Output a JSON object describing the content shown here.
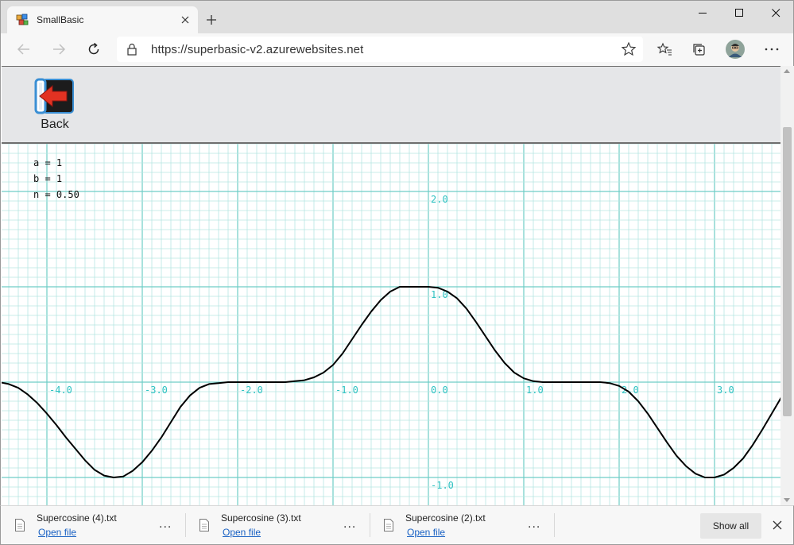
{
  "browser": {
    "tab_title": "SmallBasic",
    "url": "https://superbasic-v2.azurewebsites.net",
    "icons": [
      "smallbasic-favicon",
      "close-icon",
      "plus-icon",
      "minimize-icon",
      "maximize-icon",
      "window-close-icon",
      "back-arrow-icon",
      "forward-arrow-icon",
      "refresh-icon",
      "lock-icon",
      "star-icon",
      "favorites-icon",
      "collections-icon",
      "profile-avatar",
      "more-icon"
    ]
  },
  "app": {
    "back_label": "Back",
    "params": [
      "a = 1",
      "b = 1",
      "n = 0.50"
    ],
    "colors": {
      "grid_minor": "#b6e6e3",
      "grid_major": "#6fcdc6",
      "axis_label": "#2fc2c2",
      "curve": "#000000",
      "toolbar_bg": "#e5e6e8"
    }
  },
  "chart_data": {
    "type": "line",
    "title": "",
    "xlabel": "",
    "ylabel": "",
    "xlim": [
      -4.5,
      3.7
    ],
    "ylim": [
      -1.3,
      2.5
    ],
    "x_ticks": [
      -4.0,
      -3.0,
      -2.0,
      -1.0,
      0.0,
      1.0,
      2.0,
      3.0
    ],
    "x_tick_labels": [
      "-4.0",
      "-3.0",
      "-2.0",
      "-1.0",
      "0.0",
      "1.0",
      "2.0",
      "3.0"
    ],
    "y_ticks": [
      2.0,
      1.0,
      -1.0
    ],
    "y_tick_labels": [
      "2.0",
      "1.0",
      "-1.0"
    ],
    "grid": true,
    "series": [
      {
        "color": "#000000",
        "x": [
          -4.5,
          -4.4,
          -4.3,
          -4.2,
          -4.1,
          -4.0,
          -3.9,
          -3.8,
          -3.7,
          -3.6,
          -3.5,
          -3.4,
          -3.3,
          -3.2,
          -3.1,
          -3.0,
          -2.9,
          -2.8,
          -2.7,
          -2.6,
          -2.5,
          -2.4,
          -2.3,
          -2.2,
          -2.1,
          -2.0,
          -1.9,
          -1.8,
          -1.7,
          -1.6,
          -1.5,
          -1.4,
          -1.3,
          -1.2,
          -1.1,
          -1.0,
          -0.9,
          -0.8,
          -0.7,
          -0.6,
          -0.5,
          -0.4,
          -0.3,
          -0.2,
          -0.1,
          0.0,
          0.1,
          0.2,
          0.3,
          0.4,
          0.5,
          0.6,
          0.7,
          0.8,
          0.9,
          1.0,
          1.1,
          1.2,
          1.3,
          1.4,
          1.5,
          1.6,
          1.7,
          1.8,
          1.9,
          2.0,
          2.1,
          2.2,
          2.3,
          2.4,
          2.5,
          2.6,
          2.7,
          2.8,
          2.9,
          3.0,
          3.1,
          3.2,
          3.3,
          3.4,
          3.5,
          3.6,
          3.7
        ],
        "y": [
          0.0,
          -0.02,
          -0.06,
          -0.13,
          -0.22,
          -0.33,
          -0.45,
          -0.58,
          -0.7,
          -0.82,
          -0.92,
          -0.98,
          -1.0,
          -0.99,
          -0.93,
          -0.84,
          -0.72,
          -0.58,
          -0.42,
          -0.26,
          -0.14,
          -0.06,
          -0.02,
          -0.01,
          0.0,
          0.0,
          0.0,
          0.0,
          0.0,
          0.0,
          0.0,
          0.01,
          0.02,
          0.05,
          0.1,
          0.18,
          0.3,
          0.45,
          0.6,
          0.74,
          0.86,
          0.95,
          1.0,
          1.0,
          1.0,
          1.0,
          0.99,
          0.95,
          0.88,
          0.77,
          0.63,
          0.48,
          0.33,
          0.2,
          0.1,
          0.04,
          0.01,
          0.0,
          0.0,
          0.0,
          0.0,
          0.0,
          0.0,
          0.0,
          -0.01,
          -0.04,
          -0.1,
          -0.2,
          -0.33,
          -0.48,
          -0.63,
          -0.77,
          -0.88,
          -0.96,
          -1.0,
          -1.0,
          -0.97,
          -0.9,
          -0.8,
          -0.66,
          -0.5,
          -0.33,
          -0.16
        ]
      }
    ]
  },
  "downloads": {
    "items": [
      {
        "name": "Supercosine (4).txt",
        "action": "Open file"
      },
      {
        "name": "Supercosine (3).txt",
        "action": "Open file"
      },
      {
        "name": "Supercosine (2).txt",
        "action": "Open file"
      }
    ],
    "more_label": "...",
    "show_all_label": "Show all"
  }
}
